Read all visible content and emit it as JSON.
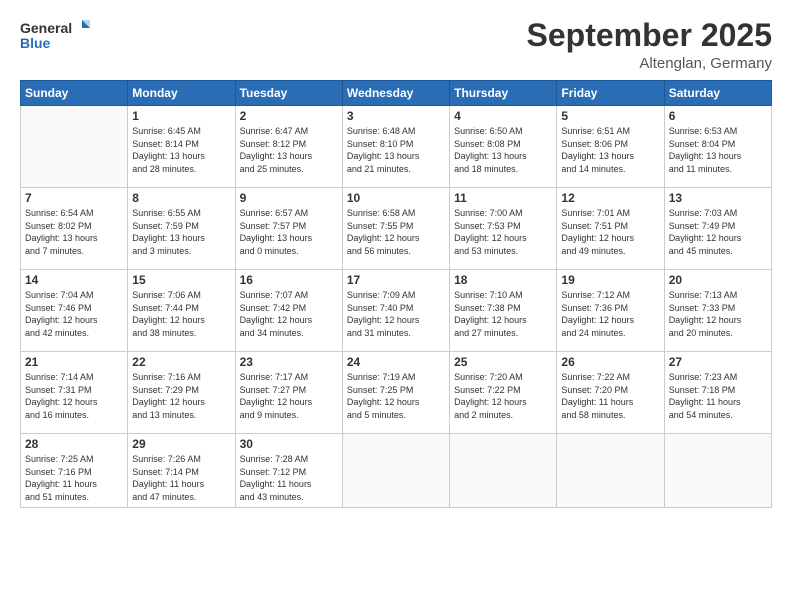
{
  "logo": {
    "line1": "General",
    "line2": "Blue"
  },
  "title": "September 2025",
  "subtitle": "Altenglan, Germany",
  "days_header": [
    "Sunday",
    "Monday",
    "Tuesday",
    "Wednesday",
    "Thursday",
    "Friday",
    "Saturday"
  ],
  "weeks": [
    [
      {
        "day": "",
        "info": ""
      },
      {
        "day": "1",
        "info": "Sunrise: 6:45 AM\nSunset: 8:14 PM\nDaylight: 13 hours\nand 28 minutes."
      },
      {
        "day": "2",
        "info": "Sunrise: 6:47 AM\nSunset: 8:12 PM\nDaylight: 13 hours\nand 25 minutes."
      },
      {
        "day": "3",
        "info": "Sunrise: 6:48 AM\nSunset: 8:10 PM\nDaylight: 13 hours\nand 21 minutes."
      },
      {
        "day": "4",
        "info": "Sunrise: 6:50 AM\nSunset: 8:08 PM\nDaylight: 13 hours\nand 18 minutes."
      },
      {
        "day": "5",
        "info": "Sunrise: 6:51 AM\nSunset: 8:06 PM\nDaylight: 13 hours\nand 14 minutes."
      },
      {
        "day": "6",
        "info": "Sunrise: 6:53 AM\nSunset: 8:04 PM\nDaylight: 13 hours\nand 11 minutes."
      }
    ],
    [
      {
        "day": "7",
        "info": "Sunrise: 6:54 AM\nSunset: 8:02 PM\nDaylight: 13 hours\nand 7 minutes."
      },
      {
        "day": "8",
        "info": "Sunrise: 6:55 AM\nSunset: 7:59 PM\nDaylight: 13 hours\nand 3 minutes."
      },
      {
        "day": "9",
        "info": "Sunrise: 6:57 AM\nSunset: 7:57 PM\nDaylight: 13 hours\nand 0 minutes."
      },
      {
        "day": "10",
        "info": "Sunrise: 6:58 AM\nSunset: 7:55 PM\nDaylight: 12 hours\nand 56 minutes."
      },
      {
        "day": "11",
        "info": "Sunrise: 7:00 AM\nSunset: 7:53 PM\nDaylight: 12 hours\nand 53 minutes."
      },
      {
        "day": "12",
        "info": "Sunrise: 7:01 AM\nSunset: 7:51 PM\nDaylight: 12 hours\nand 49 minutes."
      },
      {
        "day": "13",
        "info": "Sunrise: 7:03 AM\nSunset: 7:49 PM\nDaylight: 12 hours\nand 45 minutes."
      }
    ],
    [
      {
        "day": "14",
        "info": "Sunrise: 7:04 AM\nSunset: 7:46 PM\nDaylight: 12 hours\nand 42 minutes."
      },
      {
        "day": "15",
        "info": "Sunrise: 7:06 AM\nSunset: 7:44 PM\nDaylight: 12 hours\nand 38 minutes."
      },
      {
        "day": "16",
        "info": "Sunrise: 7:07 AM\nSunset: 7:42 PM\nDaylight: 12 hours\nand 34 minutes."
      },
      {
        "day": "17",
        "info": "Sunrise: 7:09 AM\nSunset: 7:40 PM\nDaylight: 12 hours\nand 31 minutes."
      },
      {
        "day": "18",
        "info": "Sunrise: 7:10 AM\nSunset: 7:38 PM\nDaylight: 12 hours\nand 27 minutes."
      },
      {
        "day": "19",
        "info": "Sunrise: 7:12 AM\nSunset: 7:36 PM\nDaylight: 12 hours\nand 24 minutes."
      },
      {
        "day": "20",
        "info": "Sunrise: 7:13 AM\nSunset: 7:33 PM\nDaylight: 12 hours\nand 20 minutes."
      }
    ],
    [
      {
        "day": "21",
        "info": "Sunrise: 7:14 AM\nSunset: 7:31 PM\nDaylight: 12 hours\nand 16 minutes."
      },
      {
        "day": "22",
        "info": "Sunrise: 7:16 AM\nSunset: 7:29 PM\nDaylight: 12 hours\nand 13 minutes."
      },
      {
        "day": "23",
        "info": "Sunrise: 7:17 AM\nSunset: 7:27 PM\nDaylight: 12 hours\nand 9 minutes."
      },
      {
        "day": "24",
        "info": "Sunrise: 7:19 AM\nSunset: 7:25 PM\nDaylight: 12 hours\nand 5 minutes."
      },
      {
        "day": "25",
        "info": "Sunrise: 7:20 AM\nSunset: 7:22 PM\nDaylight: 12 hours\nand 2 minutes."
      },
      {
        "day": "26",
        "info": "Sunrise: 7:22 AM\nSunset: 7:20 PM\nDaylight: 11 hours\nand 58 minutes."
      },
      {
        "day": "27",
        "info": "Sunrise: 7:23 AM\nSunset: 7:18 PM\nDaylight: 11 hours\nand 54 minutes."
      }
    ],
    [
      {
        "day": "28",
        "info": "Sunrise: 7:25 AM\nSunset: 7:16 PM\nDaylight: 11 hours\nand 51 minutes."
      },
      {
        "day": "29",
        "info": "Sunrise: 7:26 AM\nSunset: 7:14 PM\nDaylight: 11 hours\nand 47 minutes."
      },
      {
        "day": "30",
        "info": "Sunrise: 7:28 AM\nSunset: 7:12 PM\nDaylight: 11 hours\nand 43 minutes."
      },
      {
        "day": "",
        "info": ""
      },
      {
        "day": "",
        "info": ""
      },
      {
        "day": "",
        "info": ""
      },
      {
        "day": "",
        "info": ""
      }
    ]
  ]
}
